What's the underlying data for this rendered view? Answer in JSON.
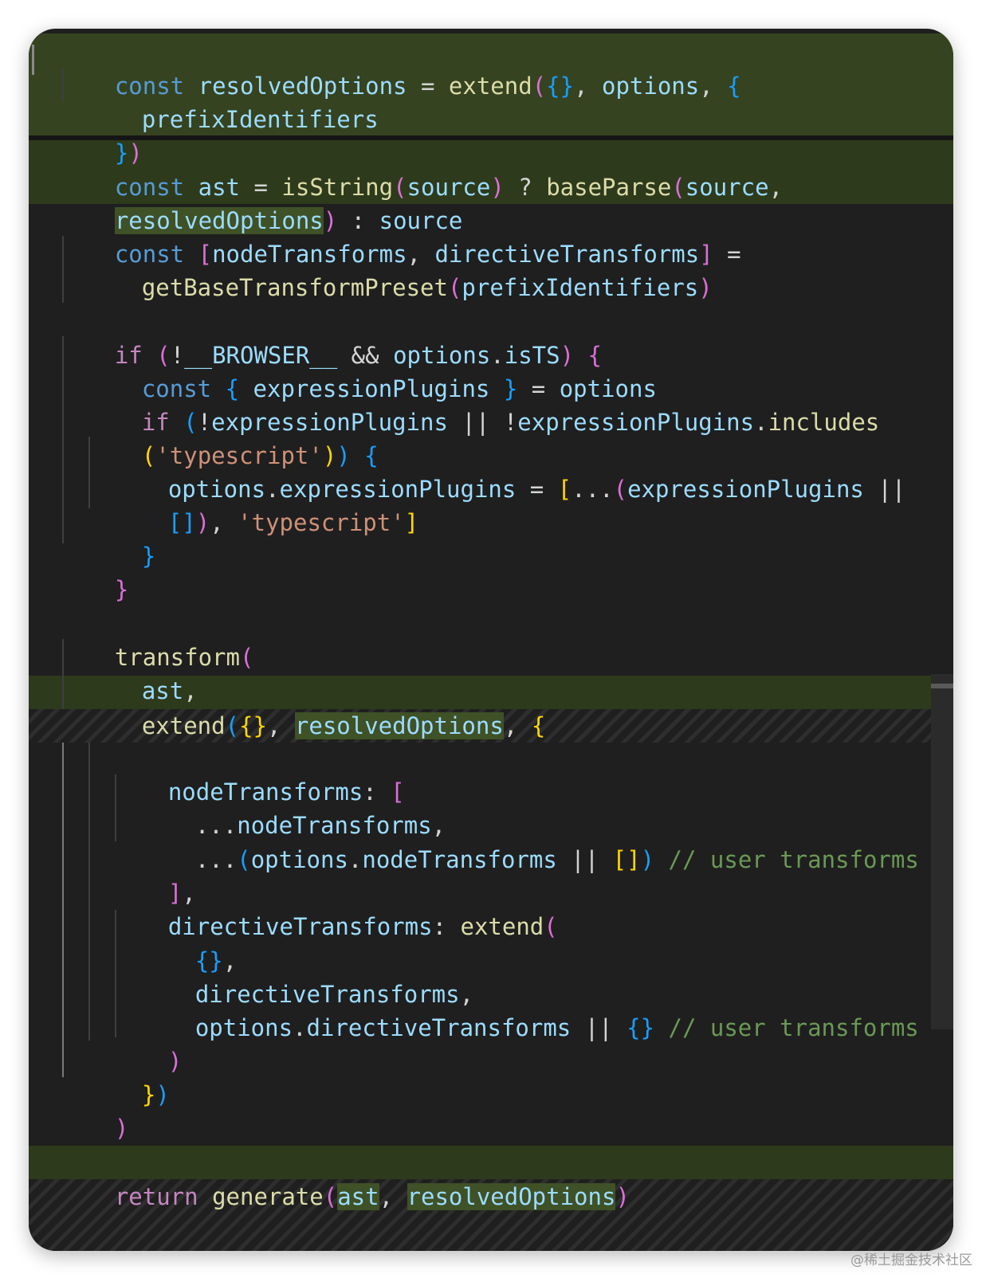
{
  "code": {
    "l1": {
      "kw": "const",
      "name": "resolvedOptions",
      "eq": " = ",
      "fn": "extend",
      "p1": "(",
      "br1": "{}",
      "comma": ", ",
      "arg": "options",
      "comma2": ", ",
      "br2": "{"
    },
    "l2": {
      "name": "prefixIdentifiers"
    },
    "l3": {
      "br": "}",
      "p": ")"
    },
    "l4": {
      "kw": "const",
      "name": "ast",
      "eq": " = ",
      "fn": "isString",
      "p1": "(",
      "arg": "source",
      "p2": ")",
      "q": " ? ",
      "fn2": "baseParse",
      "p3": "(",
      "arg2": "source",
      "comma": ","
    },
    "l5": {
      "arg": "resolvedOptions",
      "p": ")",
      "colon": " : ",
      "val": "source"
    },
    "l6": {
      "kw": "const",
      "br1": "[",
      "a": "nodeTransforms",
      "comma": ", ",
      "b": "directiveTransforms",
      "br2": "]",
      "eq": " ="
    },
    "l7": {
      "fn": "getBaseTransformPreset",
      "p1": "(",
      "arg": "prefixIdentifiers",
      "p2": ")"
    },
    "l9": {
      "kw": "if",
      "p1": " (",
      "not": "!",
      "name": "__BROWSER__",
      "and": " && ",
      "obj": "options",
      "dot": ".",
      "prop": "isTS",
      "p2": ")",
      "br": " {"
    },
    "l10": {
      "kw": "const",
      "br1": "{",
      "name": " expressionPlugins ",
      "br2": "}",
      "eq": " = ",
      "val": "options"
    },
    "l11": {
      "kw": "if",
      "p1": " (",
      "not": "!",
      "name": "expressionPlugins",
      "or": " || ",
      "not2": "!",
      "name2": "expressionPlugins",
      "dot": ".",
      "fn": "includes"
    },
    "l12": {
      "p1": "(",
      "str": "'typescript'",
      "p2": ")",
      "p3": ")",
      "br": " {"
    },
    "l13": {
      "obj": "options",
      "dot": ".",
      "prop": "expressionPlugins",
      "eq": " = ",
      "br1": "[",
      "spread": "...",
      "p1": "(",
      "name": "expressionPlugins",
      "or": " ||"
    },
    "l14": {
      "br": "[]",
      "p": ")",
      "comma": ", ",
      "str": "'typescript'",
      "br2": "]"
    },
    "l15": {
      "br": "}"
    },
    "l16": {
      "br": "}"
    },
    "l18": {
      "fn": "transform",
      "p": "("
    },
    "l19": {
      "name": "ast",
      "comma": ","
    },
    "l20": {
      "fn": "extend",
      "p1": "(",
      "br1": "{}",
      "comma": ", ",
      "arg": "resolvedOptions",
      "comma2": ", ",
      "br2": "{"
    },
    "l21": {
      "name": "nodeTransforms",
      "colon": ": ",
      "br": "["
    },
    "l22": {
      "spread": "...",
      "name": "nodeTransforms",
      "comma": ","
    },
    "l23": {
      "spread": "...",
      "p1": "(",
      "obj": "options",
      "dot": ".",
      "prop": "nodeTransforms",
      "or": " || ",
      "br": "[]",
      "p2": ")",
      "comment": " // user transforms"
    },
    "l24": {
      "br": "]",
      "comma": ","
    },
    "l25": {
      "name": "directiveTransforms",
      "colon": ": ",
      "fn": "extend",
      "p": "("
    },
    "l26": {
      "br": "{}",
      "comma": ","
    },
    "l27": {
      "name": "directiveTransforms",
      "comma": ","
    },
    "l28": {
      "obj": "options",
      "dot": ".",
      "prop": "directiveTransforms",
      "or": " || ",
      "br": "{}",
      "comment": " // user transforms"
    },
    "l29": {
      "p": ")"
    },
    "l30": {
      "br": "}",
      "p": ")"
    },
    "l31": {
      "p": ")"
    },
    "l33": {
      "kw": "return",
      "fn": " generate",
      "p1": "(",
      "arg": "ast",
      "comma": ", ",
      "arg2": "resolvedOptions",
      "p2": ")"
    }
  },
  "colors": {
    "background": "#1f1f1f",
    "diff_added": "#364320",
    "keyword": "#569cd6",
    "control": "#c586c0",
    "variable": "#9cdcfe",
    "function": "#dcdcaa",
    "string": "#ce9178",
    "comment": "#6a9955"
  },
  "watermark": "@稀土掘金技术社区"
}
